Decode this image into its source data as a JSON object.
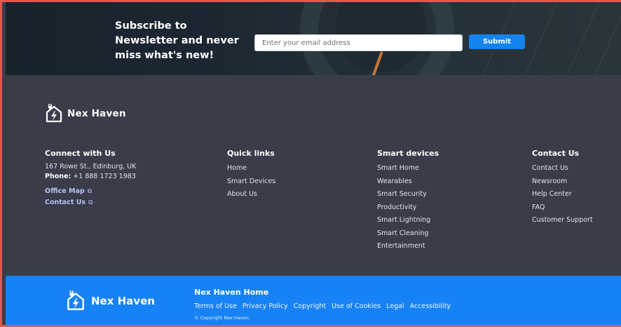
{
  "newsletter": {
    "heading": "Subscribe to Newsletter and never miss what's new!",
    "email_placeholder": "Enter your email address",
    "submit_label": "Submit"
  },
  "brand": {
    "name": "Nex Haven",
    "logo_icon": "house-plug-icon"
  },
  "connect": {
    "title": "Connect with Us",
    "address": "167 Rowe St., Edinburg, UK",
    "phone_label": "Phone:",
    "phone_value": "+1 888 1723 1983",
    "office_map": "Office Map",
    "contact_us": "Contact Us",
    "external_icon": "external-link-icon"
  },
  "quick_links": {
    "title": "Quick links",
    "items": [
      "Home",
      "Smart Devices",
      "About Us"
    ]
  },
  "smart_devices": {
    "title": "Smart devices",
    "items": [
      "Smart Home",
      "Wearables",
      "Smart Security",
      "Productivity",
      "Smart Lightning",
      "Smart Cleaning",
      "Entertainment"
    ]
  },
  "contact": {
    "title": "Contact Us",
    "items": [
      "Contact Us",
      "Newsroom",
      "Help Center",
      "FAQ",
      "Customer Support"
    ]
  },
  "bottom": {
    "home_title": "Nex Haven Home",
    "links": [
      "Terms of Use",
      "Privacy Policy",
      "Copyright",
      "Use of Cookies",
      "Legal",
      "Accessibility"
    ],
    "copyright": "© Copyright Nex Haven."
  },
  "colors": {
    "footer_bg": "#3a3c4a",
    "accent_blue": "#1682f5",
    "link_blue": "#b7c4f3",
    "border_red": "#e2584f"
  }
}
